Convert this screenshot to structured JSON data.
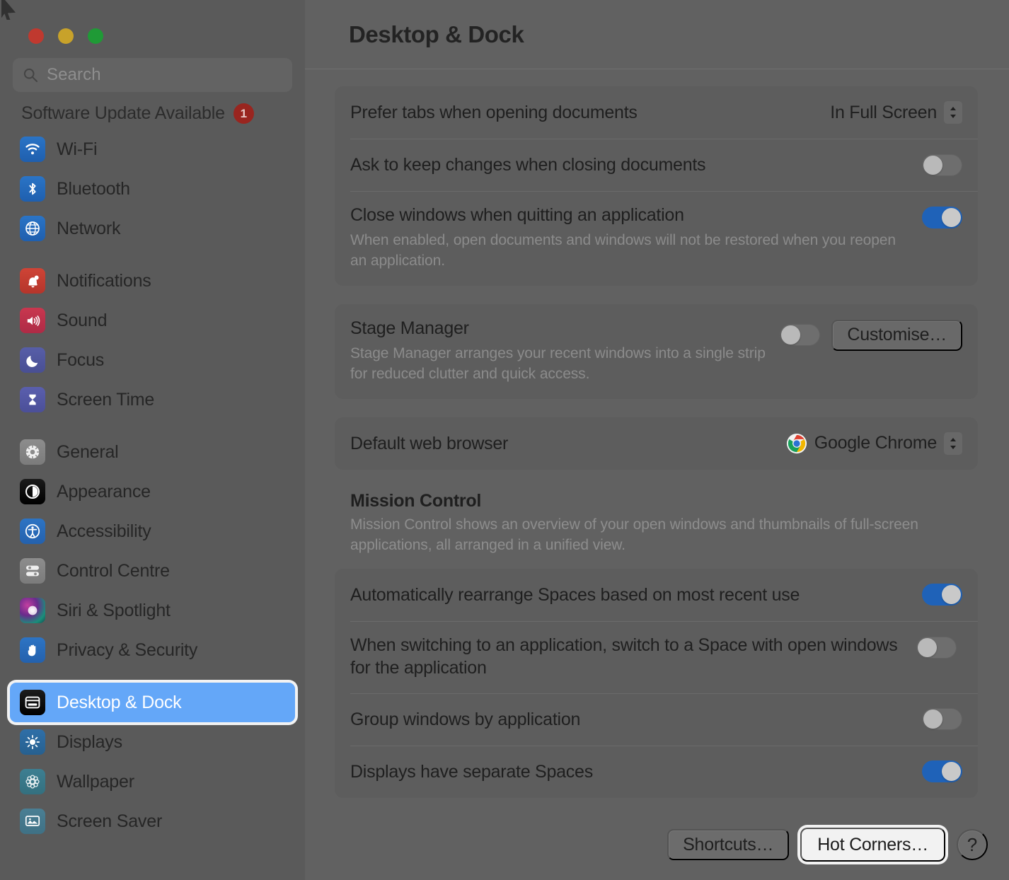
{
  "window": {
    "traffic_lights": [
      "close",
      "minimise",
      "zoom"
    ],
    "colors": {
      "accent_blue": "#1f62b8",
      "selection_blue": "#64a7f8",
      "badge_red": "#99251f",
      "window_bg": "#616161",
      "sidebar_bg": "#5a5a5a",
      "card_bg": "#5d5d5d"
    }
  },
  "search": {
    "placeholder": "Search",
    "value": ""
  },
  "software_update": {
    "label": "Software Update Available",
    "badge_count": "1"
  },
  "sidebar": {
    "groups": [
      {
        "items": [
          {
            "label": "Wi-Fi",
            "icon": "wifi-icon",
            "icon_class": "ic-wifi",
            "selected": false
          },
          {
            "label": "Bluetooth",
            "icon": "bluetooth-icon",
            "icon_class": "ic-bluetooth",
            "selected": false
          },
          {
            "label": "Network",
            "icon": "network-globe-icon",
            "icon_class": "ic-network",
            "selected": false
          }
        ]
      },
      {
        "items": [
          {
            "label": "Notifications",
            "icon": "bell-icon",
            "icon_class": "ic-notif",
            "selected": false
          },
          {
            "label": "Sound",
            "icon": "speaker-icon",
            "icon_class": "ic-sound",
            "selected": false
          },
          {
            "label": "Focus",
            "icon": "moon-icon",
            "icon_class": "ic-focus",
            "selected": false
          },
          {
            "label": "Screen Time",
            "icon": "hourglass-icon",
            "icon_class": "ic-screentime",
            "selected": false
          }
        ]
      },
      {
        "items": [
          {
            "label": "General",
            "icon": "gear-icon",
            "icon_class": "ic-general",
            "selected": false
          },
          {
            "label": "Appearance",
            "icon": "appearance-contrast-icon",
            "icon_class": "ic-appearance",
            "selected": false
          },
          {
            "label": "Accessibility",
            "icon": "accessibility-icon",
            "icon_class": "ic-access",
            "selected": false
          },
          {
            "label": "Control Centre",
            "icon": "control-centre-icon",
            "icon_class": "ic-control",
            "selected": false
          },
          {
            "label": "Siri & Spotlight",
            "icon": "siri-orb-icon",
            "icon_class": "ic-siri",
            "selected": false
          },
          {
            "label": "Privacy & Security",
            "icon": "hand-icon",
            "icon_class": "ic-privacy",
            "selected": false
          }
        ]
      },
      {
        "items": [
          {
            "label": "Desktop & Dock",
            "icon": "desktop-dock-icon",
            "icon_class": "ic-desktop",
            "selected": true
          },
          {
            "label": "Displays",
            "icon": "brightness-icon",
            "icon_class": "ic-displays",
            "selected": false
          },
          {
            "label": "Wallpaper",
            "icon": "wallpaper-flower-icon",
            "icon_class": "ic-wallpaper",
            "selected": false
          },
          {
            "label": "Screen Saver",
            "icon": "screen-saver-icon",
            "icon_class": "ic-saver",
            "selected": false
          }
        ]
      }
    ]
  },
  "main": {
    "title": "Desktop & Dock",
    "card1": {
      "rows": [
        {
          "label": "Prefer tabs when opening documents",
          "control": "popup",
          "value": "In Full Screen"
        },
        {
          "label": "Ask to keep changes when closing documents",
          "control": "toggle",
          "state": "off"
        },
        {
          "label": "Close windows when quitting an application",
          "desc": "When enabled, open documents and windows will not be restored when you reopen an application.",
          "control": "toggle",
          "state": "on"
        }
      ]
    },
    "card2": {
      "rows": [
        {
          "label": "Stage Manager",
          "desc": "Stage Manager arranges your recent windows into a single strip for reduced clutter and quick access.",
          "control": "toggle-button",
          "state": "off",
          "button_label": "Customise…"
        }
      ]
    },
    "card3": {
      "rows": [
        {
          "label": "Default web browser",
          "control": "popup-icon",
          "value": "Google Chrome",
          "icon": "chrome-icon"
        }
      ]
    },
    "mission_control": {
      "title": "Mission Control",
      "desc": "Mission Control shows an overview of your open windows and thumbnails of full-screen applications, all arranged in a unified view.",
      "rows": [
        {
          "label": "Automatically rearrange Spaces based on most recent use",
          "control": "toggle",
          "state": "on"
        },
        {
          "label": "When switching to an application, switch to a Space with open windows for the application",
          "control": "toggle",
          "state": "off"
        },
        {
          "label": "Group windows by application",
          "control": "toggle",
          "state": "off"
        },
        {
          "label": "Displays have separate Spaces",
          "control": "toggle",
          "state": "on"
        }
      ]
    },
    "bottom_bar": {
      "shortcuts_label": "Shortcuts…",
      "hot_corners_label": "Hot Corners…",
      "help_label": "?"
    }
  }
}
